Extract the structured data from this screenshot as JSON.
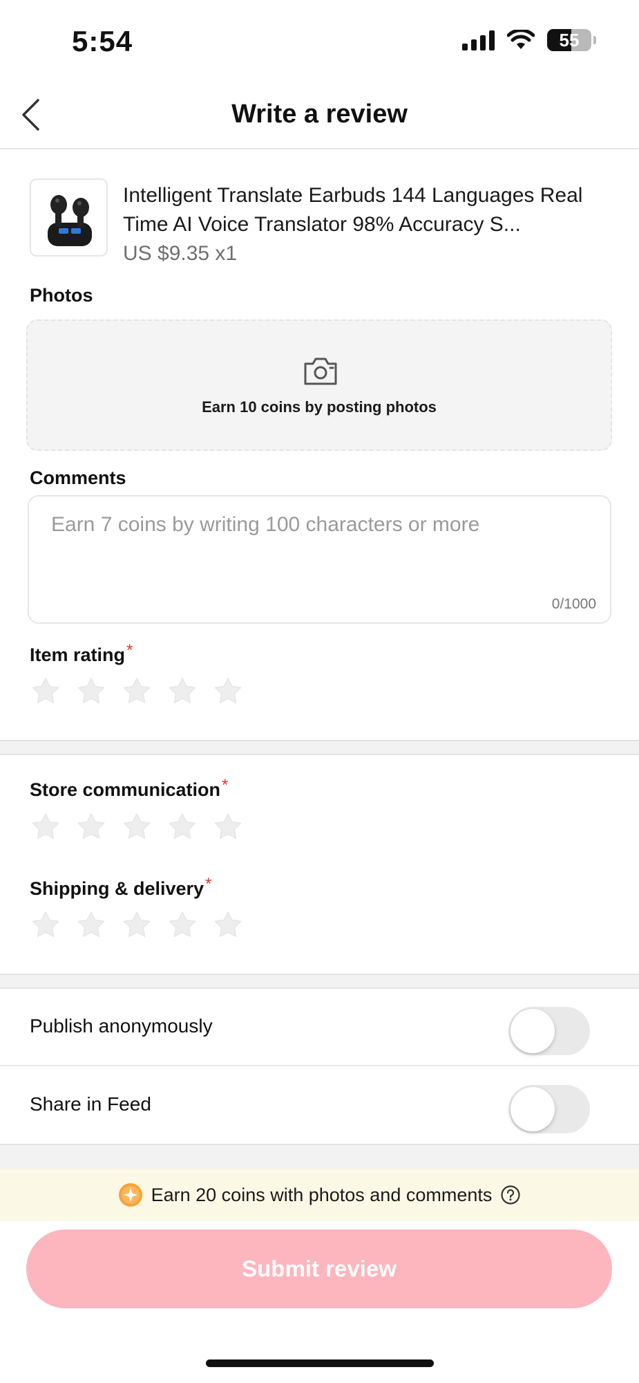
{
  "status_bar": {
    "time": "5:54",
    "battery": "55"
  },
  "header": {
    "title": "Write a review"
  },
  "product": {
    "name": "Intelligent Translate Earbuds 144 Languages Real Time AI Voice Translator 98% Accuracy S...",
    "price": "US $9.35 x1"
  },
  "photos": {
    "label": "Photos",
    "hint": "Earn 10 coins by posting photos"
  },
  "comments": {
    "label": "Comments",
    "placeholder": "Earn 7 coins by writing 100 characters or more",
    "counter": "0/1000"
  },
  "ratings": {
    "item": {
      "label": "Item rating",
      "required": "*",
      "value": 0,
      "max": 5
    },
    "store": {
      "label": "Store communication",
      "required": "*",
      "value": 0,
      "max": 5
    },
    "shipping": {
      "label": "Shipping & delivery",
      "required": "*",
      "value": 0,
      "max": 5
    }
  },
  "toggles": {
    "anonymous": {
      "label": "Publish anonymously",
      "on": false
    },
    "feed": {
      "label": "Share in Feed",
      "on": false
    }
  },
  "banner": {
    "text": "Earn 20 coins with photos and comments"
  },
  "submit": {
    "label": "Submit review"
  },
  "colors": {
    "accent": "#fdb5be",
    "required": "#e5352b",
    "banner_bg": "#fcf8e6",
    "coin": "#f7a23b"
  },
  "icons": [
    "back-arrow-icon",
    "camera-icon",
    "star-icon",
    "coin-icon",
    "help-icon",
    "signal-icon",
    "wifi-icon",
    "battery-icon"
  ]
}
